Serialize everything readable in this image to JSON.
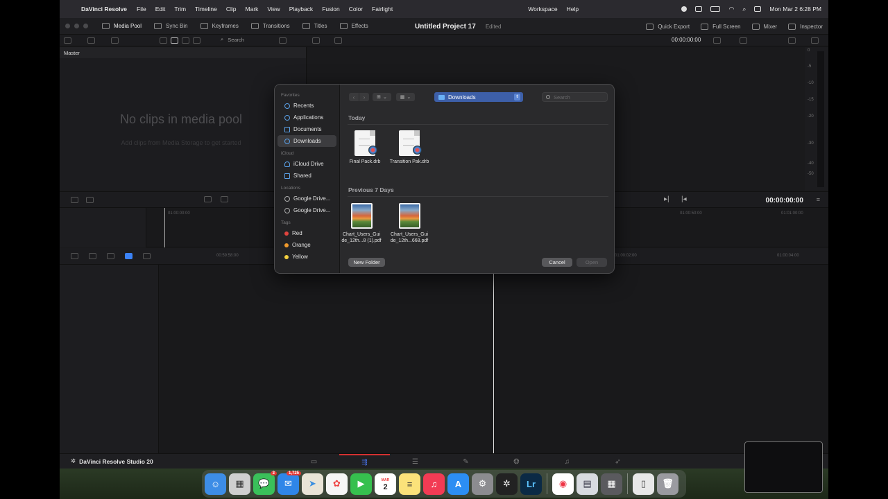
{
  "menubar": {
    "app_name": "DaVinci Resolve",
    "items": [
      "File",
      "Edit",
      "Trim",
      "Timeline",
      "Clip",
      "Mark",
      "View",
      "Playback",
      "Fusion",
      "Color",
      "Fairlight"
    ],
    "workspace": "Workspace",
    "help": "Help",
    "clock": "Mon Mar 2  6:28 PM"
  },
  "toolbar": {
    "tabs": [
      "Media Pool",
      "Sync Bin",
      "Keyframes",
      "Transitions",
      "Titles",
      "Effects"
    ],
    "project_title": "Untitled Project 17",
    "project_status": "Edited",
    "right_items": [
      "Quick Export",
      "Full Screen",
      "Mixer",
      "Inspector"
    ]
  },
  "toolbar2": {
    "search_label": "Search",
    "timecode": "00:00:00:00"
  },
  "media_pool": {
    "bin_name": "Master",
    "empty_title": "No clips in media pool",
    "empty_subtitle": "Add clips from Media Storage to get started"
  },
  "meter_labels": [
    "0",
    "-5",
    "-10",
    "-15",
    "-20",
    "-30",
    "-40",
    "-50"
  ],
  "timeline": {
    "timecode": "00:00:00:00",
    "upper_ruler": [
      "01:00:00:00",
      "01:00:50:00",
      "01:01:00:00"
    ],
    "lower_ruler": [
      "00:59:58:00",
      "01:00:02:00",
      "01:00:04:00"
    ]
  },
  "pagebar": {
    "brand": "DaVinci Resolve Studio 20"
  },
  "dock": {
    "mail_badge": "1,725",
    "messages_badge": "3",
    "calendar_month": "MAR",
    "calendar_day": "2"
  },
  "dialog": {
    "sidebar": {
      "favorites_label": "Favorites",
      "favorites": [
        "Recents",
        "Applications",
        "Documents",
        "Downloads"
      ],
      "icloud_label": "iCloud",
      "icloud": [
        "iCloud Drive",
        "Shared"
      ],
      "locations_label": "Locations",
      "locations": [
        "Google Drive...",
        "Google Drive..."
      ],
      "tags_label": "Tags",
      "tags": [
        {
          "name": "Red",
          "color": "#e0443e"
        },
        {
          "name": "Orange",
          "color": "#f09a2c"
        },
        {
          "name": "Yellow",
          "color": "#f4d03f"
        }
      ]
    },
    "location": "Downloads",
    "search_placeholder": "Search",
    "groups": [
      {
        "title": "Today",
        "files": [
          "Final Pack.drb",
          "Transition Pak.drb"
        ]
      },
      {
        "title": "Previous 7 Days",
        "files": [
          "Chart_Users_Gui de_12th...8 (1).pdf",
          "Chart_Users_Gui de_12th...668.pdf"
        ]
      }
    ],
    "new_folder": "New Folder",
    "cancel": "Cancel",
    "open": "Open"
  }
}
